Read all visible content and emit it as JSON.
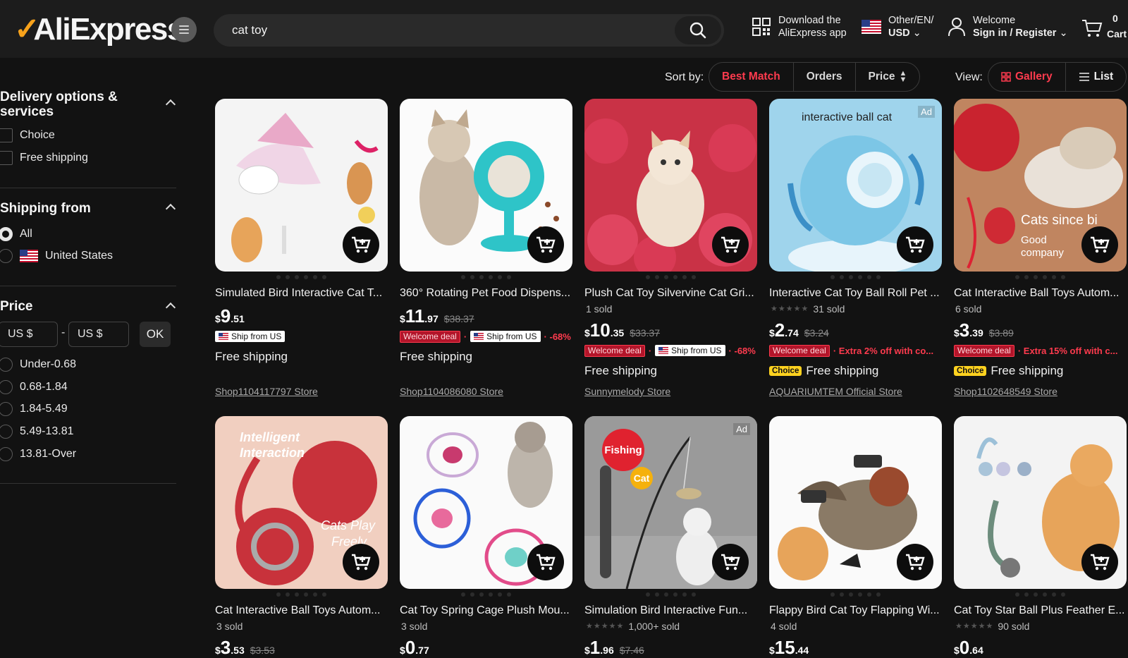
{
  "header": {
    "logo": "AliExpress",
    "search_value": "cat toy",
    "download_line1": "Download the",
    "download_line2": "AliExpress app",
    "locale_line1": "Other/EN/",
    "locale_line2": "USD",
    "welcome": "Welcome",
    "signin": "Sign in / Register",
    "cart_count": "0",
    "cart_label": "Cart"
  },
  "sidebar": {
    "delivery_title_1": "Delivery options &",
    "delivery_title_2": "services",
    "delivery_options": [
      "Choice",
      "Free shipping"
    ],
    "shipping_title": "Shipping from",
    "shipping_options": [
      "All",
      "United States"
    ],
    "price_title": "Price",
    "min_placeholder": "US $",
    "max_placeholder": "US $",
    "range_sep": "-",
    "ok": "OK",
    "price_ranges": [
      "Under-0.68",
      "0.68-1.84",
      "1.84-5.49",
      "5.49-13.81",
      "13.81-Over"
    ]
  },
  "sort": {
    "label": "Sort by:",
    "options": [
      "Best Match",
      "Orders",
      "Price"
    ],
    "view_label": "View:",
    "gallery": "Gallery",
    "list": "List"
  },
  "products": [
    {
      "title": "Simulated Bird Interactive Cat T...",
      "sold": "",
      "cur": "$",
      "int": "9",
      "dec": ".51",
      "orig": "",
      "tags": [
        "Ship from US"
      ],
      "discount": "",
      "ship": "Free shipping",
      "store": "Shop1104117797 Store"
    },
    {
      "title": "360° Rotating Pet Food Dispens...",
      "sold": "",
      "cur": "$",
      "int": "11",
      "dec": ".97",
      "orig": "$38.37",
      "tags": [
        "Welcome deal",
        "Ship from US"
      ],
      "discount": "-68%",
      "ship": "Free shipping",
      "store": "Shop1104086080 Store"
    },
    {
      "title": "Plush Cat Toy Silvervine Cat Gri...",
      "sold": "1 sold",
      "cur": "$",
      "int": "10",
      "dec": ".35",
      "orig": "$33.37",
      "tags": [
        "Welcome deal",
        "Ship from US"
      ],
      "discount": "-68%",
      "ship": "Free shipping",
      "store": "Sunnymelody Store"
    },
    {
      "title": "Interactive Cat Toy Ball Roll Pet ...",
      "sold": "31 sold",
      "cur": "$",
      "int": "2",
      "dec": ".74",
      "orig": "$3.24",
      "tags": [
        "Welcome deal"
      ],
      "discount": "Extra 2% off with co...",
      "ship": "Free shipping",
      "choice": "Choice",
      "store": "AQUARIUMTEM Official Store",
      "ad": "Ad",
      "overlay": "interactive ball cat"
    },
    {
      "title": "Cat Interactive Ball Toys Autom...",
      "sold": "6 sold",
      "cur": "$",
      "int": "3",
      "dec": ".39",
      "orig": "$3.89",
      "tags": [
        "Welcome deal"
      ],
      "discount": "Extra 15% off with c...",
      "ship": "Free shipping",
      "choice": "Choice",
      "store": "Shop1102648549 Store",
      "overlay": "Cats since bi",
      "overlay2": "Good",
      "overlay3": "company"
    },
    {
      "title": "Cat Interactive Ball Toys Autom...",
      "sold": "3 sold",
      "cur": "$",
      "int": "3",
      "dec": ".53",
      "orig": "$3.53",
      "overlay": "Intelligent",
      "overlay2": "Interaction",
      "overlay3": "Cats Play",
      "overlay4": "Freely"
    },
    {
      "title": "Cat Toy Spring Cage Plush Mou...",
      "sold": "3 sold",
      "cur": "$",
      "int": "0",
      "dec": ".77",
      "orig": ""
    },
    {
      "title": "Simulation Bird Interactive Fun...",
      "sold": "1,000+ sold",
      "cur": "$",
      "int": "1",
      "dec": ".96",
      "orig": "$7.46",
      "ad": "Ad",
      "overlay": "Fishing",
      "overlay2": "Cat"
    },
    {
      "title": "Flappy Bird Cat Toy Flapping Wi...",
      "sold": "4 sold",
      "cur": "$",
      "int": "15",
      "dec": ".44",
      "orig": ""
    },
    {
      "title": "Cat Toy Star Ball Plus Feather E...",
      "sold": "90 sold",
      "cur": "$",
      "int": "0",
      "dec": ".64",
      "orig": ""
    }
  ],
  "colors": {
    "accent": "#ff3b4e",
    "choice": "#ffd21f",
    "bg": "#121212"
  }
}
